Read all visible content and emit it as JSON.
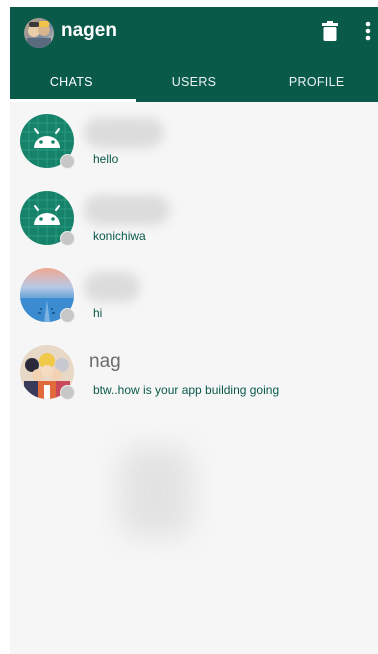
{
  "header": {
    "title": "nagen",
    "actions": {
      "delete_icon": "trash-icon",
      "more_icon": "more-vertical-icon"
    }
  },
  "tabs": [
    {
      "label": "CHATS",
      "active": true
    },
    {
      "label": "USERS",
      "active": false
    },
    {
      "label": "PROFILE",
      "active": false
    }
  ],
  "chats": [
    {
      "name": "",
      "name_hidden": true,
      "message": "hello",
      "avatar": "android-icon",
      "status": "offline"
    },
    {
      "name": "",
      "name_hidden": true,
      "message": "konichiwa",
      "avatar": "android-icon",
      "status": "offline"
    },
    {
      "name": "",
      "name_hidden": true,
      "message": "hi",
      "avatar": "landscape-photo",
      "status": "offline"
    },
    {
      "name": "nag",
      "name_hidden": false,
      "message": "btw..how is your app building going",
      "avatar": "anime-group-photo",
      "status": "offline"
    }
  ],
  "colors": {
    "primary": "#0a5a4a",
    "avatar_teal": "#16826a",
    "status_offline": "#c7c7c7",
    "background": "#f6f6f6"
  }
}
